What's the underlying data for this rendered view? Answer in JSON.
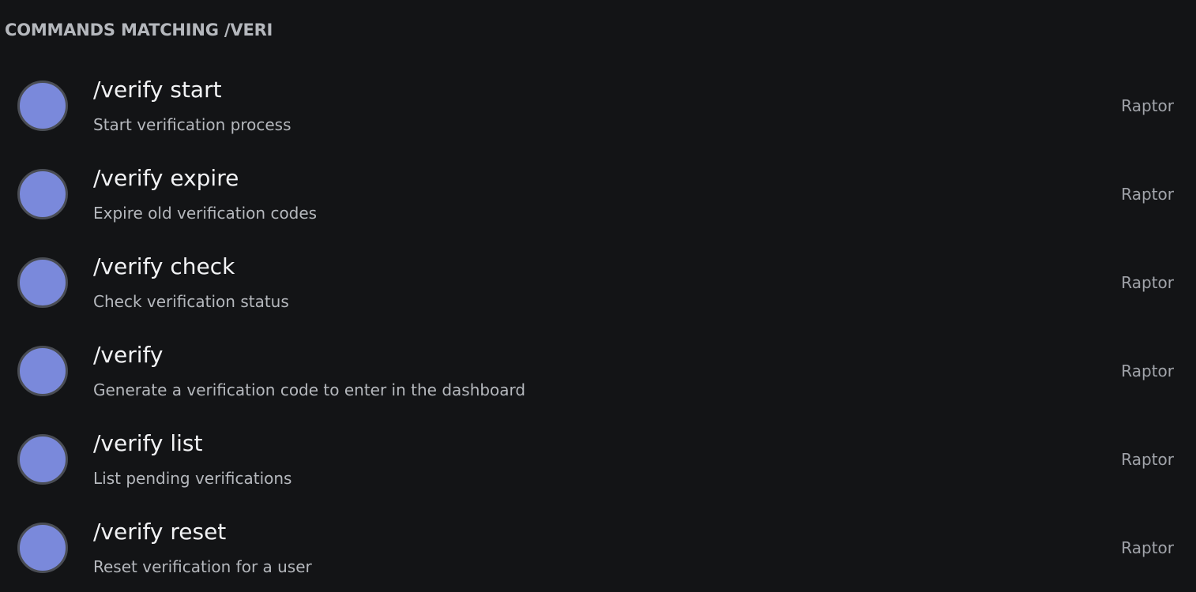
{
  "header": {
    "title": "COMMANDS MATCHING /VERI"
  },
  "colors": {
    "background": "#131416",
    "avatar": "#7a89db",
    "avatar_ring": "#4a4d54",
    "title_text": "#f2f3f5",
    "secondary_text": "#b5b8bd"
  },
  "commands": [
    {
      "name": "/verify start",
      "description": "Start verification process",
      "source": "Raptor",
      "icon": "bot-avatar-icon"
    },
    {
      "name": "/verify expire",
      "description": "Expire old verification codes",
      "source": "Raptor",
      "icon": "bot-avatar-icon"
    },
    {
      "name": "/verify check",
      "description": "Check verification status",
      "source": "Raptor",
      "icon": "bot-avatar-icon"
    },
    {
      "name": "/verify",
      "description": "Generate a verification code to enter in the dashboard",
      "source": "Raptor",
      "icon": "bot-avatar-icon"
    },
    {
      "name": "/verify list",
      "description": "List pending verifications",
      "source": "Raptor",
      "icon": "bot-avatar-icon"
    },
    {
      "name": "/verify reset",
      "description": "Reset verification for a user",
      "source": "Raptor",
      "icon": "bot-avatar-icon"
    }
  ]
}
